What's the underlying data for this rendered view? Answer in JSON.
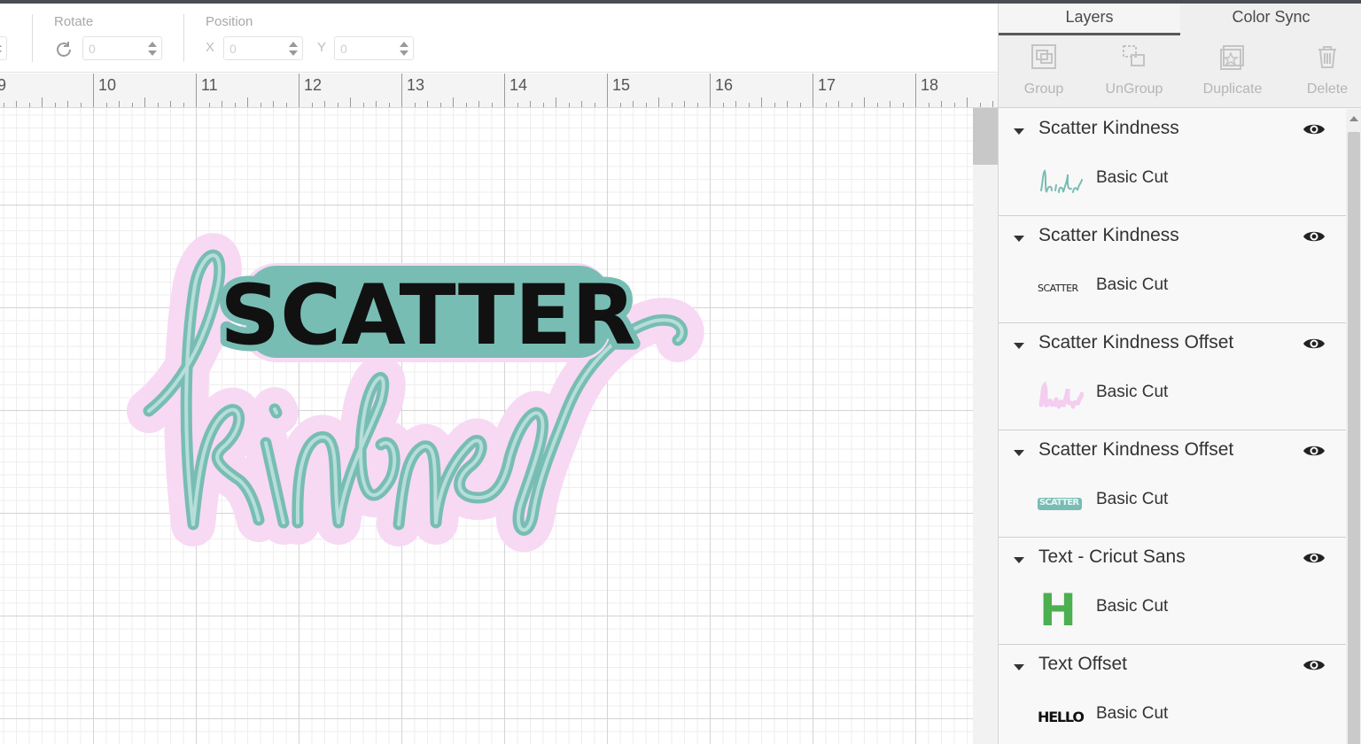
{
  "toolbar": {
    "rotate_label": "Rotate",
    "rotate_value": "0",
    "position_label": "Position",
    "x_letter": "X",
    "x_value": "0",
    "y_letter": "Y",
    "y_value": "0"
  },
  "ruler": {
    "marks": [
      "9",
      "10",
      "11",
      "12",
      "13",
      "14",
      "15",
      "16",
      "17",
      "18"
    ]
  },
  "canvas": {
    "design_top_word": "SCATTER",
    "design_script_word": "kindness",
    "colors": {
      "teal": "#78bdb4",
      "pink": "#f7d9f4",
      "black": "#111111"
    }
  },
  "panel": {
    "tabs": [
      {
        "label": "Layers",
        "active": true
      },
      {
        "label": "Color Sync",
        "active": false
      }
    ],
    "actions": [
      {
        "label": "Group",
        "icon": "group-icon"
      },
      {
        "label": "UnGroup",
        "icon": "ungroup-icon"
      },
      {
        "label": "Duplicate",
        "icon": "duplicate-icon"
      },
      {
        "label": "Delete",
        "icon": "trash-icon"
      }
    ],
    "layers": [
      {
        "name": "Scatter Kindness",
        "operation": "Basic Cut",
        "thumb": "kindness-teal"
      },
      {
        "name": "Scatter Kindness",
        "operation": "Basic Cut",
        "thumb": "scatter-outline"
      },
      {
        "name": "Scatter Kindness Offset",
        "operation": "Basic Cut",
        "thumb": "kindness-pink"
      },
      {
        "name": "Scatter Kindness Offset",
        "operation": "Basic Cut",
        "thumb": "scatter-teal"
      },
      {
        "name": "Text - Cricut Sans",
        "operation": "Basic Cut",
        "thumb": "h-green"
      },
      {
        "name": "Text Offset",
        "operation": "Basic Cut",
        "thumb": "hello-black"
      }
    ],
    "thumb_text": {
      "scatter": "SCATTER",
      "h": "H",
      "hello": "HELLO"
    }
  }
}
